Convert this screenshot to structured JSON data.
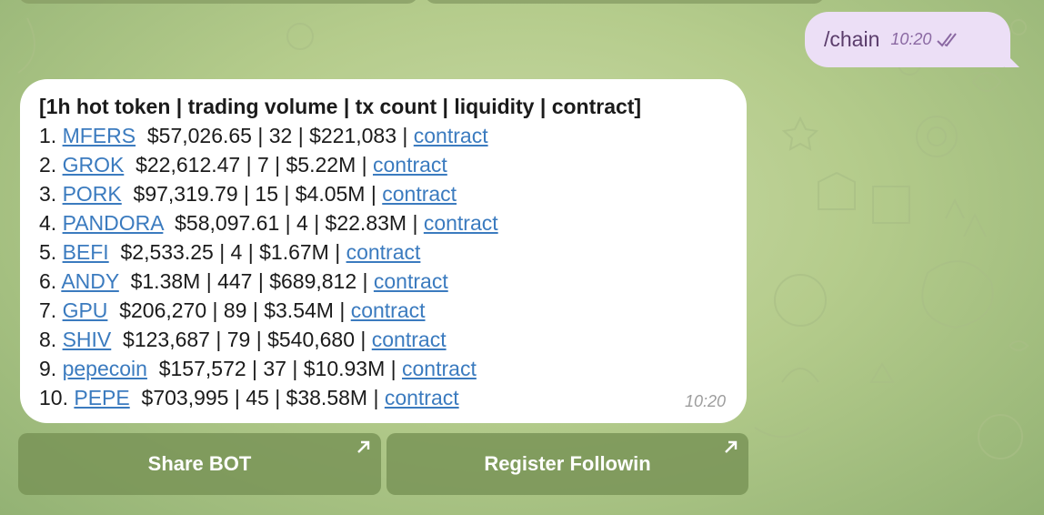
{
  "outgoing_message": {
    "text": "/chain",
    "time": "10:20",
    "status_icon": "double-check-icon"
  },
  "incoming_message": {
    "header": "[1h hot token | trading volume | tx count | liquidity | contract]",
    "rows": [
      {
        "num": "1.",
        "token": "MFERS",
        "stats": "$57,026.65 | 32 | $221,083 |",
        "link": "contract"
      },
      {
        "num": "2.",
        "token": "GROK",
        "stats": "$22,612.47 | 7 | $5.22M |",
        "link": "contract"
      },
      {
        "num": "3.",
        "token": "PORK",
        "stats": "$97,319.79 | 15 | $4.05M |",
        "link": "contract"
      },
      {
        "num": "4.",
        "token": "PANDORA",
        "stats": "$58,097.61 | 4 | $22.83M |",
        "link": "contract"
      },
      {
        "num": "5.",
        "token": "BEFI",
        "stats": "$2,533.25 | 4 | $1.67M |",
        "link": "contract"
      },
      {
        "num": "6.",
        "token": "ANDY",
        "stats": "$1.38M | 447 | $689,812 |",
        "link": "contract"
      },
      {
        "num": "7.",
        "token": "GPU",
        "stats": "$206,270 | 89 | $3.54M |",
        "link": "contract"
      },
      {
        "num": "8.",
        "token": "SHIV",
        "stats": "$123,687 | 79 | $540,680 |",
        "link": "contract"
      },
      {
        "num": "9.",
        "token": "pepecoin",
        "stats": "$157,572 | 37 | $10.93M |",
        "link": "contract"
      },
      {
        "num": "10.",
        "token": "PEPE",
        "stats": "$703,995 | 45 | $38.58M |",
        "link": "contract"
      }
    ],
    "time": "10:20"
  },
  "keyboard": {
    "buttons": [
      {
        "label": "Share BOT",
        "icon": "open-link-arrow-icon"
      },
      {
        "label": "Register Followin",
        "icon": "open-link-arrow-icon"
      }
    ]
  },
  "colors": {
    "link": "#3b7bbf",
    "outgoing_bubble": "#ecdff6",
    "button_bg": "#7a9256"
  }
}
